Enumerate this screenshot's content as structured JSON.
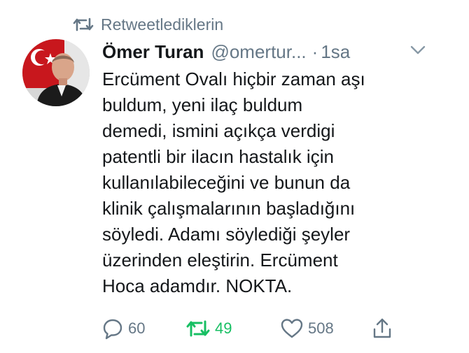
{
  "context": {
    "retweet_label": "Retweetlediklerin"
  },
  "author": {
    "name": "Ömer Turan",
    "handle": "@omertur...",
    "separator": "·",
    "time": "1sa"
  },
  "tweet": {
    "lines": [
      "Ercüment Ovalı hiçbir zaman aşı",
      "buldum, yeni ilaç buldum",
      "demedi, ismini açıkça verdigi",
      "patentli bir ilacın hastalık için",
      "kullanılabileceğini ve bunun da",
      "klinik çalışmalarının başladığını",
      "söyledi. Adamı söylediği şeyler",
      "üzerinden eleştirin. Ercüment",
      "Hoca adamdır. NOKTA."
    ]
  },
  "actions": {
    "reply_count": "60",
    "retweet_count": "49",
    "like_count": "508"
  },
  "icons": {
    "retweet_context": "retweet-icon",
    "more": "chevron-down-icon",
    "reply": "reply-icon",
    "retweet": "retweet-icon",
    "like": "heart-icon",
    "share": "share-icon"
  },
  "colors": {
    "text": "#14171a",
    "secondary": "#657786",
    "retweet_active": "#17bf63",
    "background": "#ffffff"
  }
}
